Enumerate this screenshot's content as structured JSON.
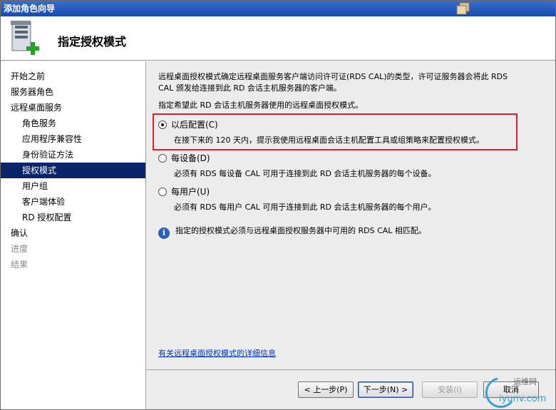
{
  "window": {
    "title": "添加角色向导"
  },
  "header": {
    "title": "指定授权模式"
  },
  "sidebar": {
    "items": [
      {
        "label": "开始之前",
        "level": 0,
        "state": "normal"
      },
      {
        "label": "服务器角色",
        "level": 0,
        "state": "normal"
      },
      {
        "label": "远程桌面服务",
        "level": 0,
        "state": "normal"
      },
      {
        "label": "角色服务",
        "level": 1,
        "state": "normal"
      },
      {
        "label": "应用程序兼容性",
        "level": 1,
        "state": "normal"
      },
      {
        "label": "身份验证方法",
        "level": 1,
        "state": "normal"
      },
      {
        "label": "授权模式",
        "level": 1,
        "state": "selected"
      },
      {
        "label": "用户组",
        "level": 1,
        "state": "normal"
      },
      {
        "label": "客户端体验",
        "level": 1,
        "state": "normal"
      },
      {
        "label": "RD 授权配置",
        "level": 1,
        "state": "normal"
      },
      {
        "label": "确认",
        "level": 0,
        "state": "normal"
      },
      {
        "label": "进度",
        "level": 0,
        "state": "disabled"
      },
      {
        "label": "结果",
        "level": 0,
        "state": "disabled"
      }
    ]
  },
  "main": {
    "description_line1": "远程桌面授权模式确定远程桌面服务客户端访问许可证(RDS CAL)的类型，许可证服务器会将此 RDS",
    "description_line2": "CAL 颁发给连接到此 RD 会话主机服务器的客户端。",
    "prompt": "指定希望此 RD 会话主机服务器使用的远程桌面授权模式。",
    "options": [
      {
        "label": "以后配置(C)",
        "checked": true,
        "description": "在接下来的 120 天内，提示我使用远程桌面会话主机配置工具或组策略来配置授权模式。"
      },
      {
        "label": "每设备(D)",
        "checked": false,
        "description": "必须有 RDS 每设备 CAL 可用于连接到此 RD 会话主机服务器的每个设备。"
      },
      {
        "label": "每用户(U)",
        "checked": false,
        "description": "必须有 RDS 每用户 CAL 可用于连接到此 RD 会话主机服务器的每个用户。"
      }
    ],
    "info_text": "指定的授权模式必须与远程桌面授权服务器中可用的 RDS CAL 相匹配。",
    "info_icon": "info-icon",
    "more_link": "有关远程桌面授权模式的详细信息",
    "highlight_color": "#e0202a"
  },
  "footer": {
    "back_label": "< 上一步(P)",
    "next_label": "下一步(N) >",
    "install_label": "安装(I)",
    "cancel_label": "取消"
  },
  "watermark": {
    "text_top": "运维网",
    "text_bottom": "iyunv.com"
  }
}
